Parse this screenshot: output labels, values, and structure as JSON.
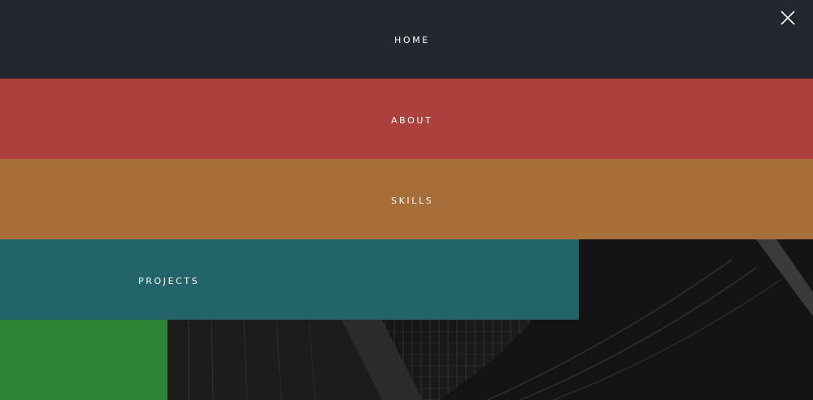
{
  "menu": {
    "items": [
      {
        "label": "HOME"
      },
      {
        "label": "ABOUT"
      },
      {
        "label": "SKILLS"
      },
      {
        "label": "PROJECTS"
      },
      {
        "label": ""
      }
    ]
  },
  "colors": {
    "home": "#22282d",
    "about": "#ab403d",
    "skills": "#a86e39",
    "projects": "#23646b",
    "fifth": "#2e8336",
    "text": "#ffffff"
  },
  "icons": {
    "close": "close-icon"
  }
}
